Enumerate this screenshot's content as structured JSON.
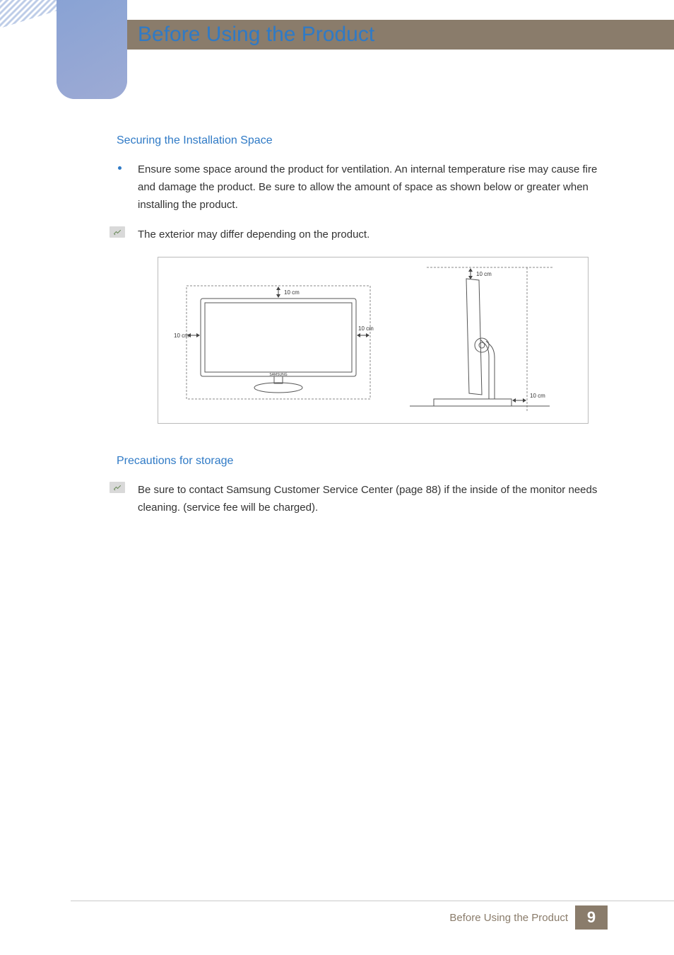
{
  "header": {
    "title": "Before Using the Product"
  },
  "sections": {
    "securing": {
      "heading": "Securing the Installation Space",
      "bullet": "Ensure some space around the product for ventilation. An internal temperature rise may cause fire and damage the product. Be sure to allow the amount of space as shown below or greater when installing the product.",
      "note": "The exterior may differ depending on the product.",
      "diagram": {
        "label_top_front": "10 cm",
        "label_left_front": "10 cm",
        "label_right_front": "10 cm",
        "label_top_side": "10 cm",
        "label_back_side": "10 cm",
        "brand": "SAMSUNG"
      }
    },
    "precautions": {
      "heading": "Precautions for storage",
      "note": "Be sure to contact Samsung Customer Service Center (page 88) if the inside of the monitor needs cleaning. (service fee will be charged)."
    }
  },
  "footer": {
    "title": "Before Using the Product",
    "page": "9"
  }
}
